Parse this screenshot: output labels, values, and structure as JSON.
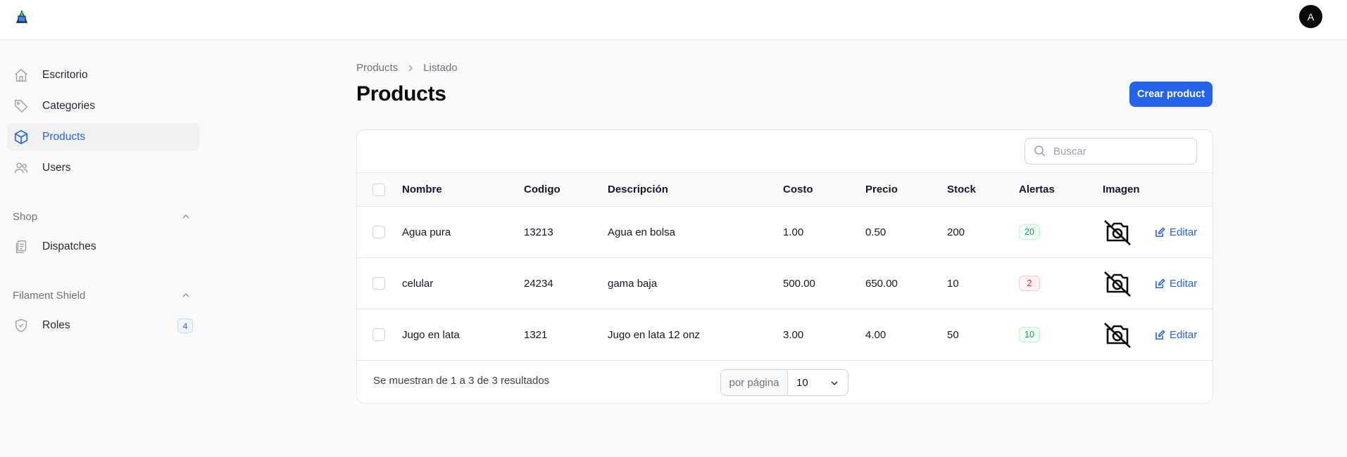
{
  "header": {
    "avatar_initial": "A"
  },
  "sidebar": {
    "items": [
      {
        "label": "Escritorio",
        "icon": "home-icon"
      },
      {
        "label": "Categories",
        "icon": "tag-icon"
      },
      {
        "label": "Products",
        "icon": "cube-icon",
        "active": true
      },
      {
        "label": "Users",
        "icon": "users-icon"
      }
    ],
    "groups": [
      {
        "label": "Shop",
        "items": [
          {
            "label": "Dispatches",
            "icon": "clipboard-icon"
          }
        ]
      },
      {
        "label": "Filament Shield",
        "items": [
          {
            "label": "Roles",
            "icon": "shield-icon",
            "badge": "4"
          }
        ]
      }
    ]
  },
  "breadcrumb": {
    "parent": "Products",
    "current": "Listado"
  },
  "page": {
    "title": "Products",
    "create_button": "Crear product"
  },
  "search": {
    "placeholder": "Buscar"
  },
  "table": {
    "columns": [
      "Nombre",
      "Codigo",
      "Descripción",
      "Costo",
      "Precio",
      "Stock",
      "Alertas",
      "Imagen"
    ],
    "edit_label": "Editar",
    "rows": [
      {
        "nombre": "Agua pura",
        "codigo": "13213",
        "descripcion": "Agua en bolsa",
        "costo": "1.00",
        "precio": "0.50",
        "stock": "200",
        "alertas": "20",
        "alert_status": "green"
      },
      {
        "nombre": "celular",
        "codigo": "24234",
        "descripcion": "gama baja",
        "costo": "500.00",
        "precio": "650.00",
        "stock": "10",
        "alertas": "2",
        "alert_status": "red"
      },
      {
        "nombre": "Jugo en lata",
        "codigo": "1321",
        "descripcion": "Jugo en lata 12 onz",
        "costo": "3.00",
        "precio": "4.00",
        "stock": "50",
        "alertas": "10",
        "alert_status": "green"
      }
    ]
  },
  "pagination": {
    "summary": "Se muestran de 1 a 3 de 3 resultados",
    "per_page_label": "por página",
    "per_page_value": "10"
  },
  "colors": {
    "primary": "#2563eb",
    "alert_green": "#16a34a",
    "alert_red": "#dc2626"
  }
}
